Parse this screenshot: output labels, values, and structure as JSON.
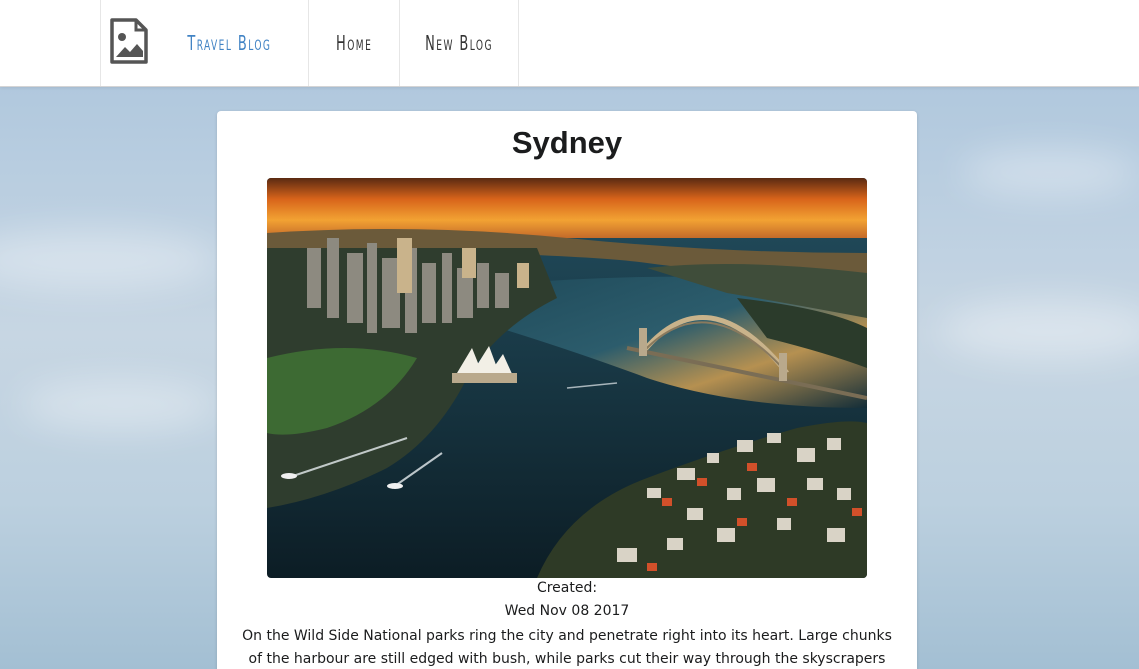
{
  "navbar": {
    "brand_label": "Travel Blog",
    "brand_icon": "image-icon",
    "items": [
      {
        "label": "Home"
      },
      {
        "label": "New Blog"
      }
    ],
    "brand_color": "#4183c4"
  },
  "post": {
    "title": "Sydney",
    "image_description_icon": "harbour-photo",
    "created_label": "Created:",
    "created_date": "Wed Nov 08 2017",
    "body": "On the Wild Side National parks ring the city and penetrate right into its heart. Large chunks of the harbour are still edged with bush, while parks cut their way through the skyscrapers and"
  }
}
